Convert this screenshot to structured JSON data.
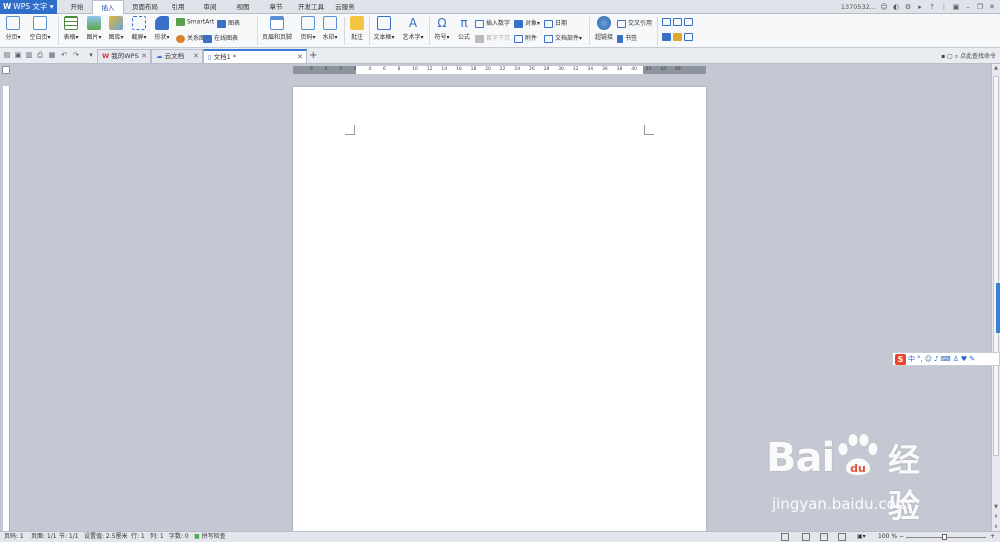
{
  "app": {
    "name": "WPS 文字",
    "account": "1370532..."
  },
  "menu": {
    "tabs": [
      "开始",
      "插入",
      "页面布局",
      "引用",
      "审阅",
      "视图",
      "章节",
      "开发工具",
      "云服务"
    ],
    "active": "插入"
  },
  "ribbon": {
    "page_break": "分页",
    "blank_page": "空白页",
    "table": "表格",
    "picture": "图片",
    "gallery": "图库",
    "screenshot": "截屏",
    "shape": "形状",
    "smartart": "SmartArt",
    "chart": "图表",
    "relation": "关系图",
    "online_chart": "在线图表",
    "header_footer": "页眉和页脚",
    "page_number": "页码",
    "watermark": "水印",
    "comment": "批注",
    "textbox": "文本框",
    "wordart": "艺术字",
    "symbol": "符号",
    "formula": "公式",
    "insert_number": "插入数字",
    "object": "对象",
    "date": "日期",
    "first_sink": "首字下沉",
    "attachment": "附件",
    "doc_parts": "文档部件",
    "hyperlink": "超链接",
    "crossref": "交叉引用",
    "bookmark": "书签"
  },
  "doc_tabs": [
    {
      "label": "我的WPS"
    },
    {
      "label": "云文档"
    },
    {
      "label": "文档1 *"
    }
  ],
  "command_search": "点此查找命令",
  "ruler_ticks": [
    "6",
    "4",
    "2",
    "2",
    "4",
    "6",
    "8",
    "10",
    "12",
    "14",
    "16",
    "18",
    "20",
    "22",
    "24",
    "26",
    "28",
    "30",
    "32",
    "34",
    "36",
    "38",
    "40",
    "42",
    "44",
    "46"
  ],
  "ime": {
    "mode": "中"
  },
  "watermark": {
    "brand": "Bai",
    "brand_cn": "经验",
    "url": "jingyan.baidu.com"
  },
  "status": {
    "page_no": "页码: 1",
    "pages": "页面: 1/1",
    "section": "节: 1/1",
    "setting": "设置值: 2.5厘米",
    "row": "行: 1",
    "col": "列: 1",
    "words": "字数: 0",
    "spell": "拼写检查",
    "zoom": "100 %"
  },
  "colors": {
    "accent": "#2f6fcb",
    "watermark_red": "#e8452c"
  }
}
